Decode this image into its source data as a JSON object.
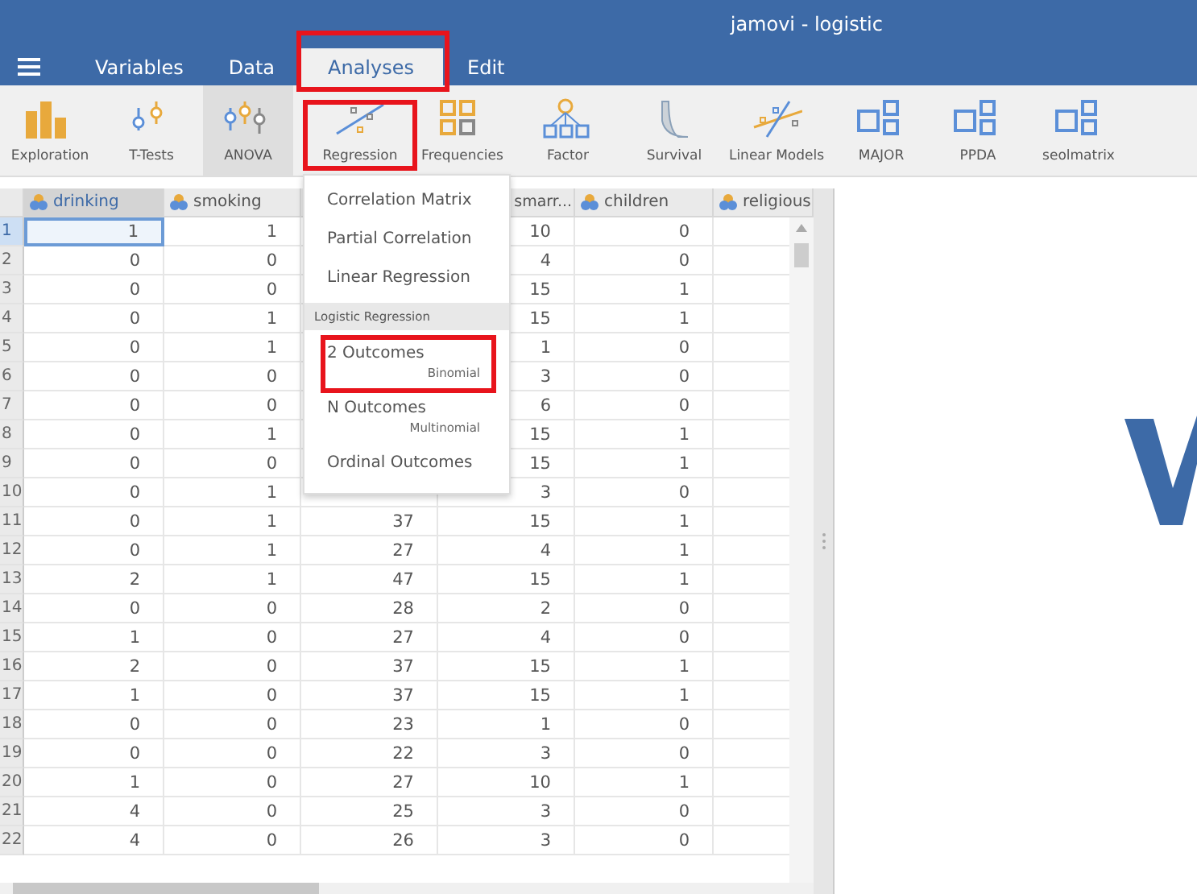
{
  "window": {
    "title": "jamovi - logistic"
  },
  "tabs": [
    {
      "label": "Variables",
      "selected": false,
      "annotated": false
    },
    {
      "label": "Data",
      "selected": false,
      "annotated": false
    },
    {
      "label": "Analyses",
      "selected": true,
      "annotated": true
    },
    {
      "label": "Edit",
      "selected": false,
      "annotated": false
    }
  ],
  "ribbon": [
    {
      "label": "Exploration",
      "kind": "bars",
      "selected": false,
      "annotated": false
    },
    {
      "label": "T-Tests",
      "kind": "ttest",
      "selected": false,
      "annotated": false
    },
    {
      "label": "ANOVA",
      "kind": "anova",
      "selected": true,
      "annotated": false
    },
    {
      "label": "Regression",
      "kind": "regression",
      "selected": false,
      "annotated": true
    },
    {
      "label": "Frequencies",
      "kind": "freq",
      "selected": false,
      "annotated": false
    },
    {
      "label": "Factor",
      "kind": "tree",
      "selected": false,
      "annotated": false
    },
    {
      "label": "Survival",
      "kind": "curve",
      "selected": false,
      "annotated": false
    },
    {
      "label": "Linear Models",
      "kind": "linear",
      "selected": false,
      "annotated": false
    },
    {
      "label": "MAJOR",
      "kind": "module",
      "selected": false,
      "annotated": false
    },
    {
      "label": "PPDA",
      "kind": "module",
      "selected": false,
      "annotated": false
    },
    {
      "label": "seolmatrix",
      "kind": "module",
      "selected": false,
      "annotated": false
    }
  ],
  "grid": {
    "columns": [
      {
        "name": "drinking",
        "kind": "nominal",
        "selected": true
      },
      {
        "name": "smoking",
        "kind": "nominal",
        "selected": false
      },
      {
        "selected": false
      },
      {
        "name": "smarr...",
        "selected": false
      },
      {
        "name": "children",
        "kind": "nominal",
        "selected": false
      },
      {
        "name": "religious",
        "kind": "nominal",
        "selected": false
      }
    ],
    "rows": [
      {
        "number": "1",
        "selected": true,
        "cells": [
          "1",
          "1",
          null,
          "10",
          "0"
        ]
      },
      {
        "number": "2",
        "selected": false,
        "cells": [
          "0",
          "0",
          null,
          "4",
          "0"
        ]
      },
      {
        "number": "3",
        "selected": false,
        "cells": [
          "0",
          "0",
          null,
          "15",
          "1"
        ]
      },
      {
        "number": "4",
        "selected": false,
        "cells": [
          "0",
          "1",
          null,
          "15",
          "1"
        ]
      },
      {
        "number": "5",
        "selected": false,
        "cells": [
          "0",
          "1",
          null,
          "1",
          "0"
        ]
      },
      {
        "number": "6",
        "selected": false,
        "cells": [
          "0",
          "0",
          null,
          "3",
          "0"
        ]
      },
      {
        "number": "7",
        "selected": false,
        "cells": [
          "0",
          "0",
          null,
          "6",
          "0"
        ]
      },
      {
        "number": "8",
        "selected": false,
        "cells": [
          "0",
          "1",
          null,
          "15",
          "1"
        ]
      },
      {
        "number": "9",
        "selected": false,
        "cells": [
          "0",
          "0",
          null,
          "15",
          "1"
        ]
      },
      {
        "number": "10",
        "selected": false,
        "cells": [
          "0",
          "1",
          null,
          "3",
          "0"
        ]
      },
      {
        "number": "11",
        "selected": false,
        "cells": [
          "0",
          "1",
          "37",
          "15",
          "1"
        ]
      },
      {
        "number": "12",
        "selected": false,
        "cells": [
          "0",
          "1",
          "27",
          "4",
          "1"
        ]
      },
      {
        "number": "13",
        "selected": false,
        "cells": [
          "2",
          "1",
          "47",
          "15",
          "1"
        ]
      },
      {
        "number": "14",
        "selected": false,
        "cells": [
          "0",
          "0",
          "28",
          "2",
          "0"
        ]
      },
      {
        "number": "15",
        "selected": false,
        "cells": [
          "1",
          "0",
          "27",
          "4",
          "0"
        ]
      },
      {
        "number": "16",
        "selected": false,
        "cells": [
          "2",
          "0",
          "37",
          "15",
          "1"
        ]
      },
      {
        "number": "17",
        "selected": false,
        "cells": [
          "1",
          "0",
          "37",
          "15",
          "1"
        ]
      },
      {
        "number": "18",
        "selected": false,
        "cells": [
          "0",
          "0",
          "23",
          "1",
          "0"
        ]
      },
      {
        "number": "19",
        "selected": false,
        "cells": [
          "0",
          "0",
          "22",
          "3",
          "0"
        ]
      },
      {
        "number": "20",
        "selected": false,
        "cells": [
          "1",
          "0",
          "27",
          "10",
          "1"
        ]
      },
      {
        "number": "21",
        "selected": false,
        "cells": [
          "4",
          "0",
          "25",
          "3",
          "0"
        ]
      },
      {
        "number": "22",
        "selected": false,
        "cells": [
          "4",
          "0",
          "26",
          "3",
          "0"
        ]
      }
    ]
  },
  "menu": {
    "items": [
      {
        "kind": "item",
        "label": "Correlation Matrix",
        "annotated": false
      },
      {
        "kind": "item",
        "label": "Partial Correlation",
        "annotated": false
      },
      {
        "kind": "item",
        "label": "Linear Regression",
        "annotated": false
      },
      {
        "kind": "header",
        "label": "Logistic Regression"
      },
      {
        "kind": "item",
        "label": "2 Outcomes",
        "sublabel": "Binomial",
        "annotated": true
      },
      {
        "kind": "item",
        "label": "N Outcomes",
        "sublabel": "Multinomial",
        "annotated": false
      },
      {
        "kind": "item",
        "label": "Ordinal Outcomes",
        "annotated": false
      }
    ]
  }
}
